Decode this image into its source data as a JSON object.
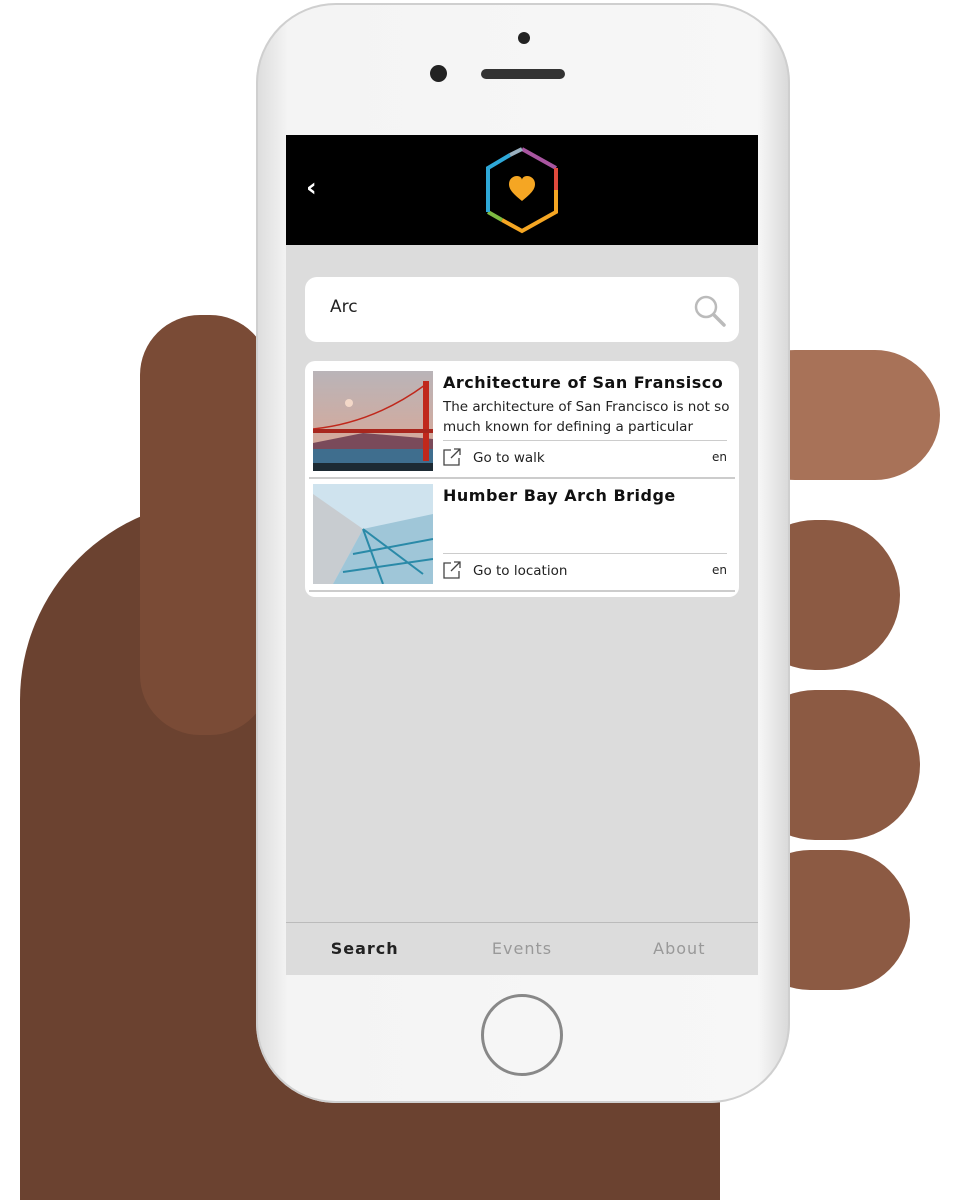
{
  "header": {
    "back_label": "‹",
    "logo": "hexagon-heart-logo",
    "logo_colors": [
      "#a855a0",
      "#e04a3c",
      "#f5a623",
      "#7dbb42",
      "#2ea8d8"
    ]
  },
  "search": {
    "value": "Arc",
    "icon": "search-icon"
  },
  "results": [
    {
      "title": "Architecture of San Fransisco",
      "description": "The architecture of San Francisco is not so much known for defining a particular",
      "action": "Go to walk",
      "lang": "en"
    },
    {
      "title": "Humber Bay Arch Bridge",
      "description": "",
      "action": "Go to location",
      "lang": "en"
    }
  ],
  "tabs": [
    {
      "label": "Search",
      "active": true
    },
    {
      "label": "Events",
      "active": false
    },
    {
      "label": "About",
      "active": false
    }
  ]
}
